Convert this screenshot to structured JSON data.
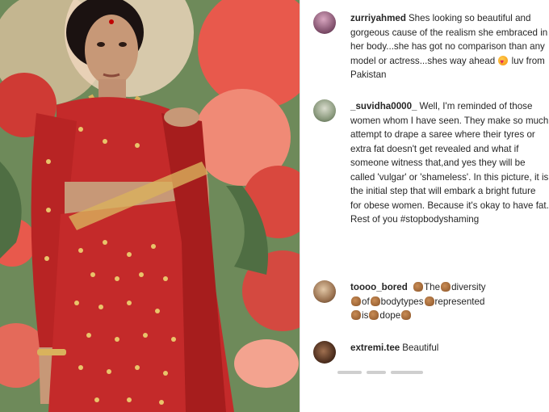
{
  "colors": {
    "username": "#262626",
    "text": "#262626",
    "divider": "#e6e6e6",
    "saree": "#c42a2a",
    "saree_dark": "#8e1313",
    "gold": "#d9b25c",
    "skin": "#c79877",
    "background_flowers": "#e8594c",
    "background_leaves": "#6e8a5a"
  },
  "post_image": {
    "alt": "photo-of-woman-in-red-saree"
  },
  "comments": [
    {
      "username": "zurriyahmed",
      "text": "Shes looking so beautiful and gorgeous cause of the realism she embraced in her body...she has got no comparison than any model or actress...shes way ahead",
      "emoji": "heart-eyes-emoji",
      "text_after": " luv from Pakistan"
    },
    {
      "username": "_suvidha0000_",
      "text": "Well, I'm reminded of those women whom I have seen. They make so much attempt to drape a saree where their tyres or extra fat doesn't get revealed and what if someone witness that,and yes they will be called 'vulgar' or 'shameless'. In this picture, it is the initial step that will embark a bright future for obese women. Because it's okay to have fat. Rest of you #stopbodyshaming"
    },
    {
      "username": "toooo_bored",
      "words": [
        "The",
        "diversity",
        "of",
        "bodytypes",
        "represented",
        "is",
        "dope"
      ],
      "emoji": "clapping-hands-emoji"
    },
    {
      "username": "extremi.tee",
      "text": "Beautiful"
    }
  ]
}
